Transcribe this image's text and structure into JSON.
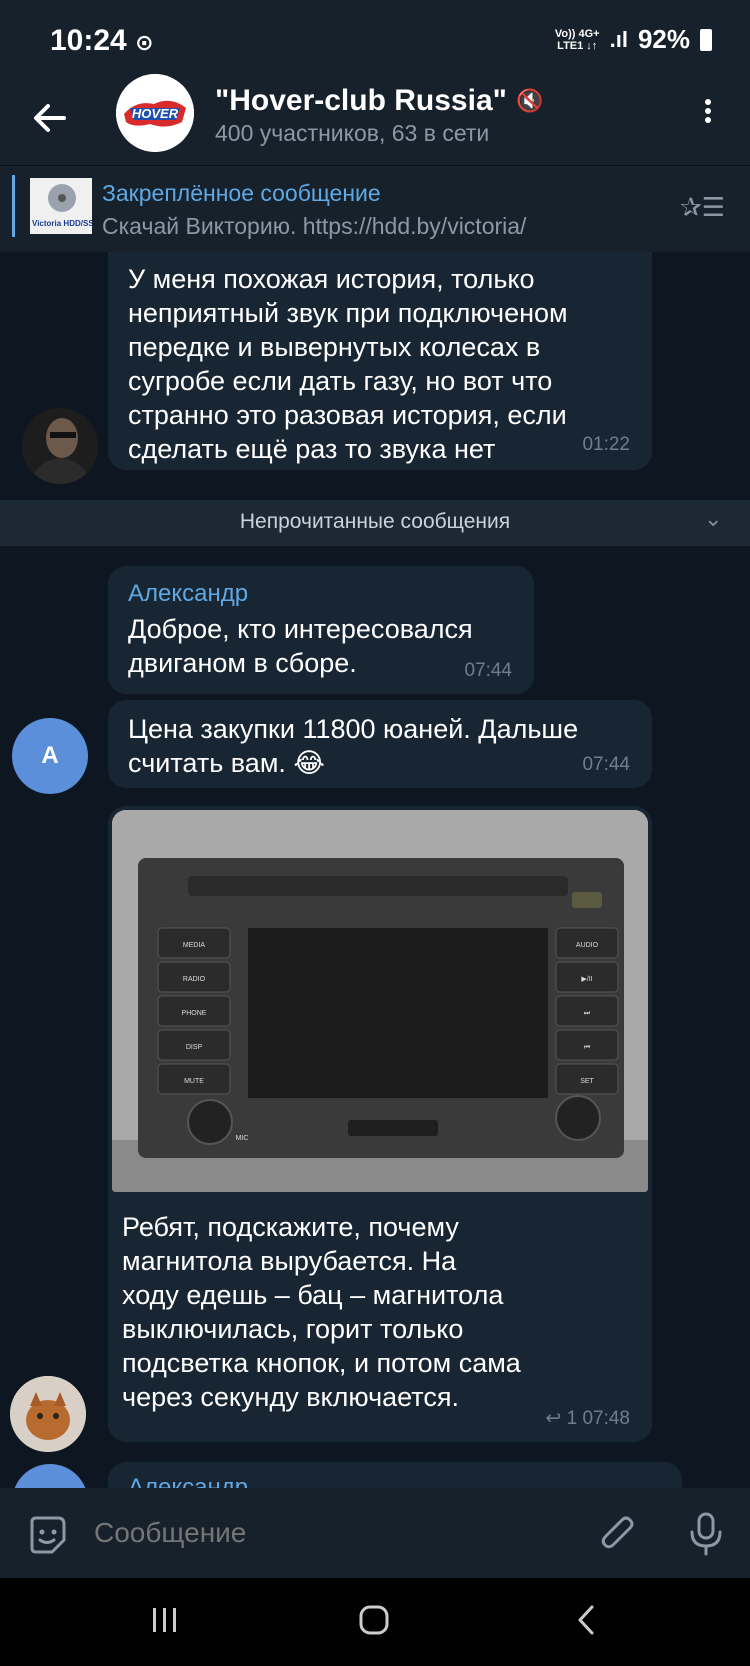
{
  "status": {
    "time": "10:24",
    "signal_top": "Vo)) 4G+",
    "signal_bottom": "LTE1 ↓↑",
    "battery": "92%"
  },
  "header": {
    "title": "\"Hover-club Russia\"",
    "subtitle": "400 участников, 63 в сети",
    "avatar_logo_text": "HOVER"
  },
  "pinned": {
    "title": "Закреплённое сообщение",
    "text": "Скачай Викторию. https://hdd.by/victoria/",
    "thumb_text": "Victoria HDD/SSD"
  },
  "messages": [
    {
      "text_lines": [
        "У меня похожая история, только",
        "неприятный звук при подключеном",
        "передке и вывернутых колесах в",
        "сугробе если дать газу, но вот что",
        "странно это разовая история, если",
        "сделать ещё раз то звука нет"
      ],
      "time": "01:22"
    },
    {
      "sender": "Александр",
      "text_lines": [
        "Доброе, кто интересовался",
        "двиганом в сборе."
      ],
      "time": "07:44"
    },
    {
      "text_lines": [
        "Цена закупки 11800 юаней. Дальше",
        "считать вам. 😂"
      ],
      "time": "07:44",
      "avatar_letter": "А"
    },
    {
      "photo_labels": [
        "MEDIA",
        "RADIO",
        "PHONE",
        "DISP",
        "MUTE",
        "AUDIO",
        "▶/II",
        "⏭",
        "⏮",
        "SET",
        "MIC"
      ],
      "text_lines": [
        "Ребят, подскажите, почему",
        "магнитола вырубается. На",
        "ходу едешь – бац – магнитола",
        "выключилась, горит только",
        "подсветка кнопок, и потом сама",
        "через секунду включается."
      ],
      "replies": "1",
      "time": "07:48"
    },
    {
      "sender_partial": "Александр"
    }
  ],
  "unread_label": "Непрочитанные сообщения",
  "input": {
    "placeholder": "Сообщение"
  },
  "colors": {
    "background": "#0e1621",
    "bubble": "#182533",
    "accent": "#5fa8e4",
    "bar": "#17212b"
  },
  "icons": [
    "back-arrow-icon",
    "mute-icon",
    "more-vert-icon",
    "pin-list-icon",
    "chevron-down-icon",
    "sticker-icon",
    "paperclip-icon",
    "microphone-icon",
    "recents-icon",
    "home-icon",
    "nav-back-icon",
    "reply-icon"
  ]
}
